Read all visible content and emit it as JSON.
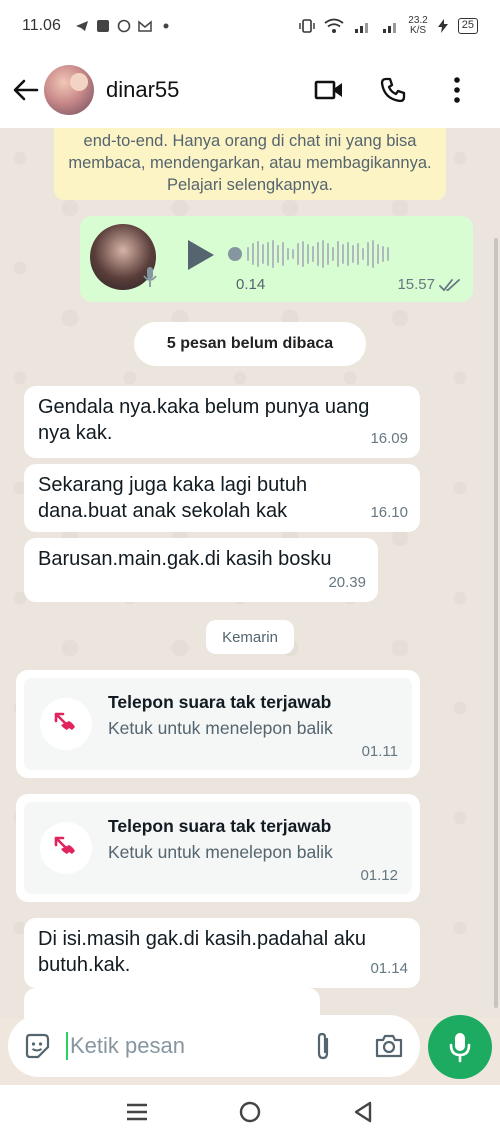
{
  "status_bar": {
    "time": "11.06",
    "net_speed_value": "23.2",
    "net_speed_unit": "K/S",
    "battery": "25"
  },
  "header": {
    "contact_name": "dinar55",
    "icons": [
      "back-arrow-icon",
      "video-call-icon",
      "phone-icon",
      "more-vert-icon"
    ]
  },
  "chat": {
    "encryption_notice": "end-to-end. Hanya orang di chat ini yang bisa membaca, mendengarkan, atau membagikannya. Pelajari selengkapnya.",
    "voice_message": {
      "position": "0.14",
      "time": "15.57"
    },
    "unread_label": "5 pesan belum dibaca",
    "messages": [
      {
        "text": "Gendala nya.kaka belum punya uang nya kak.",
        "time": "16.09"
      },
      {
        "text": "Sekarang juga kaka lagi butuh dana.buat anak sekolah kak",
        "time": "16.10"
      },
      {
        "text": "Barusan.main.gak.di kasih bosku",
        "time": "20.39"
      }
    ],
    "date_divider": "Kemarin",
    "missed_calls": [
      {
        "title": "Telepon suara tak terjawab",
        "subtitle": "Ketuk untuk menelepon balik",
        "time": "01.11"
      },
      {
        "title": "Telepon suara tak terjawab",
        "subtitle": "Ketuk untuk menelepon balik",
        "time": "01.12"
      }
    ],
    "last_message": {
      "text": "Di isi.masih gak.di kasih.padahal aku butuh.kak.",
      "time": "01.14"
    }
  },
  "input": {
    "placeholder": "Ketik pesan"
  },
  "colors": {
    "accent_green": "#1daa61",
    "outgoing_bubble": "#d9fdd3",
    "missed_call_red": "#e0245e",
    "encryption_banner": "#fdf4c5"
  }
}
